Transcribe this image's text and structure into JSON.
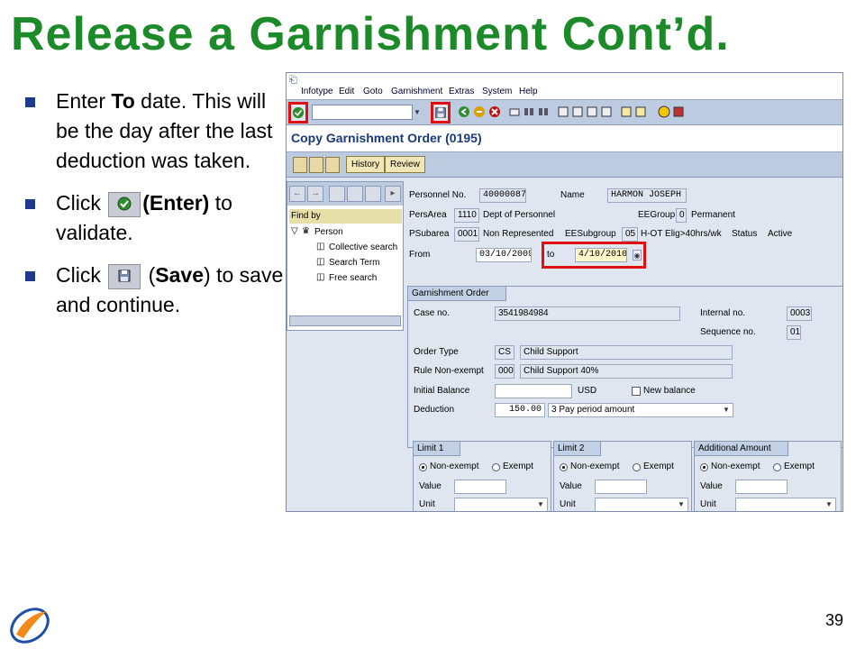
{
  "slide": {
    "title": "Release a Garnishment Cont’d.",
    "page_number": "39",
    "bullets": [
      {
        "pre": "Enter ",
        "bold": "To",
        "post": " date. This will be the day after the last deduction was taken."
      },
      {
        "pre": "Click ",
        "bold": "(Enter)",
        "post": " to validate."
      },
      {
        "pre": "Click ",
        "bold": "Save",
        "post": " to save and continue."
      }
    ],
    "bullet3_paren_open": "(",
    "bullet3_paren_close": ")",
    "bullet2_tail_bold": "."
  },
  "sap": {
    "menu": [
      "Infotype",
      "Edit",
      "Goto",
      "Garnishment",
      "Extras",
      "System",
      "Help"
    ],
    "screen_title": "Copy Garnishment Order (0195)",
    "app_buttons": [
      "History",
      "Review"
    ],
    "nav": {
      "find_by": "Find by",
      "root": "Person",
      "items": [
        "Collective search",
        "Search Term",
        "Free search"
      ]
    },
    "header": {
      "personnel_no_label": "Personnel No.",
      "personnel_no": "40000087",
      "name_label": "Name",
      "name": "HARMON JOSEPH",
      "persarea_label": "PersArea",
      "persarea_code": "1110",
      "persarea_text": "Dept of Personnel",
      "eegroup_label": "EEGroup",
      "eegroup_code": "0",
      "eegroup_text": "Permanent",
      "psubarea_label": "PSubarea",
      "psubarea_code": "0001",
      "psubarea_text": "Non Represented",
      "eesubgroup_label": "EESubgroup",
      "eesubgroup_code": "05",
      "eesubgroup_text": "H-OT Elig>40hrs/wk",
      "status_label": "Status",
      "status_text": "Active",
      "from_label": "From",
      "from_date": "03/10/2009",
      "to_label": "to",
      "to_date": "4/10/2010"
    },
    "order": {
      "group_title": "Garnishment Order",
      "case_no_label": "Case no.",
      "case_no": "3541984984",
      "internal_no_label": "Internal no.",
      "internal_no": "0003",
      "sequence_no_label": "Sequence no.",
      "sequence_no": "01",
      "order_type_label": "Order Type",
      "order_type_code": "CS",
      "order_type_text": "Child Support",
      "rule_label": "Rule Non-exempt",
      "rule_code": "000",
      "rule_text": "Child Support 40%",
      "initial_balance_label": "Initial Balance",
      "currency": "USD",
      "new_balance_label": "New balance",
      "deduction_label": "Deduction",
      "deduction_value": "150.00",
      "deduction_text": "3 Pay period amount"
    },
    "limits": [
      {
        "title": "Limit 1",
        "opt1": "Non-exempt",
        "opt2": "Exempt",
        "value_label": "Value",
        "unit_label": "Unit"
      },
      {
        "title": "Limit 2",
        "opt1": "Non-exempt",
        "opt2": "Exempt",
        "value_label": "Value",
        "unit_label": "Unit"
      },
      {
        "title": "Additional Amount",
        "opt1": "Non-exempt",
        "opt2": "Exempt",
        "value_label": "Value",
        "unit_label": "Unit"
      }
    ]
  }
}
